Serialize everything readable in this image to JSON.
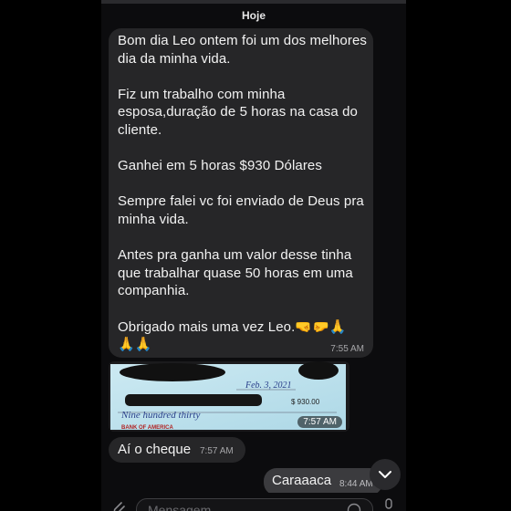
{
  "date_separator": "Hoje",
  "messages": {
    "main": {
      "text": "Bom dia Leo ontem foi um dos melhores dia da minha vida.\n\nFiz um trabalho com minha esposa,duração de 5 horas na casa do cliente.\n\nGanhei em 5 horas $930 Dólares\n\nSempre falei vc foi enviado de Deus pra minha vida.\n\nAntes pra ganha um valor desse tinha que trabalhar quase 50 horas em uma companhia.\n\nObrigado mais uma vez Leo.🤜🤛🙏\n🙏🙏",
      "time": "7:55 AM"
    },
    "photo": {
      "time": "7:57 AM",
      "cheque_date": "Feb. 3, 2021",
      "cheque_amount": "$ 930.00",
      "cheque_words": "Nine hundred thirty",
      "bank": "BANK OF AMERICA"
    },
    "cheque": {
      "text": "Aí o cheque",
      "time": "7:57 AM"
    },
    "reply": {
      "text": "Caraaaca",
      "time": "8:44 AM"
    }
  },
  "input": {
    "placeholder": "Mensagem"
  },
  "colors": {
    "incoming_bubble": "#262628",
    "outgoing_bubble": "#3b3b3e",
    "background": "#0c0c0e"
  }
}
